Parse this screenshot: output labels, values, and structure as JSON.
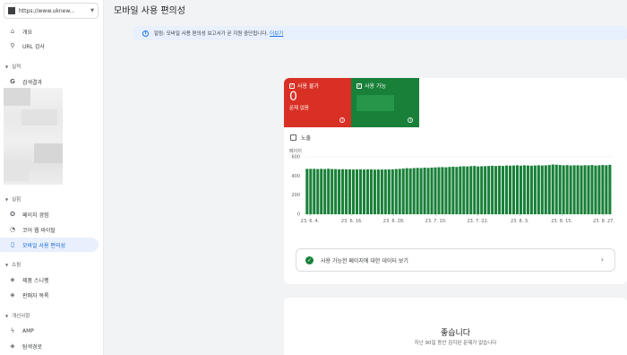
{
  "property": {
    "url": "https://www.uknew..."
  },
  "sidebar": {
    "items_top": [
      {
        "label": "개요",
        "icon": "home-icon"
      },
      {
        "label": "URL 검사",
        "icon": "search-icon"
      }
    ],
    "section_performance": "실적",
    "perf_items": [
      {
        "label": "검색결과",
        "icon": "google-g-icon"
      }
    ],
    "section_experience": "실험",
    "exp_items": [
      {
        "label": "페이지 경험",
        "icon": "page-experience-icon"
      },
      {
        "label": "코어 웹 바이탈",
        "icon": "speed-icon"
      },
      {
        "label": "모바일 사용 편의성",
        "icon": "phone-icon"
      }
    ],
    "section_shopping": "쇼핑",
    "shop_items": [
      {
        "label": "제품 스니펫",
        "icon": "tag-icon"
      },
      {
        "label": "판매자 목록",
        "icon": "tag-icon"
      }
    ],
    "section_enhancements": "개선사항",
    "enh_items": [
      {
        "label": "AMP",
        "icon": "bolt-icon"
      },
      {
        "label": "탐색경로",
        "icon": "tag-icon"
      }
    ]
  },
  "header": {
    "title": "모바일 사용 편의성"
  },
  "alert": {
    "text": "알림: 모바일 사용 편의성 보고서가 곧 지원 중단됩니다.",
    "link": "더보기"
  },
  "summary": {
    "unusable": {
      "label": "사용 불가",
      "count": "0",
      "sub": "문제 없음",
      "color": "#d93025"
    },
    "usable": {
      "label": "사용 가능",
      "color": "#188038"
    }
  },
  "legend": {
    "label": "노출"
  },
  "chart_data": {
    "type": "bar",
    "ylabel": "페이지",
    "yticks": [
      600,
      400,
      200,
      0
    ],
    "ylim": [
      0,
      600
    ],
    "xticks": [
      "23. 6. 4.",
      "23. 6. 16.",
      "23. 6. 28.",
      "23. 7. 10.",
      "23. 7. 22.",
      "23. 8. 3.",
      "23. 8. 15.",
      "23. 8. 27."
    ],
    "series": [
      {
        "color": "#188038",
        "values": [
          475,
          475,
          475,
          473,
          475,
          473,
          476,
          473,
          472,
          470,
          471,
          470,
          470,
          468,
          469,
          470,
          468,
          469,
          470,
          467,
          468,
          468,
          468,
          470,
          470,
          473,
          475,
          478,
          482,
          480,
          483,
          485,
          483,
          487,
          485,
          488,
          490,
          492,
          493,
          491,
          495,
          497,
          495,
          500,
          502,
          500,
          503,
          505,
          500,
          502,
          503,
          505,
          507,
          505,
          508,
          505,
          510,
          508,
          510,
          512,
          508,
          512,
          510,
          508,
          510,
          512,
          510,
          512,
          515,
          520,
          518,
          515,
          512,
          514,
          510,
          512,
          512,
          510,
          513,
          512,
          515,
          510,
          512,
          515,
          513,
          517
        ]
      }
    ]
  },
  "data_button": {
    "label": "사용 가능한 페이지에 대한 데이터 보기"
  },
  "good": {
    "title": "좋습니다",
    "sub": "지난 90일 동안 감지된 문제가 없습니다"
  }
}
